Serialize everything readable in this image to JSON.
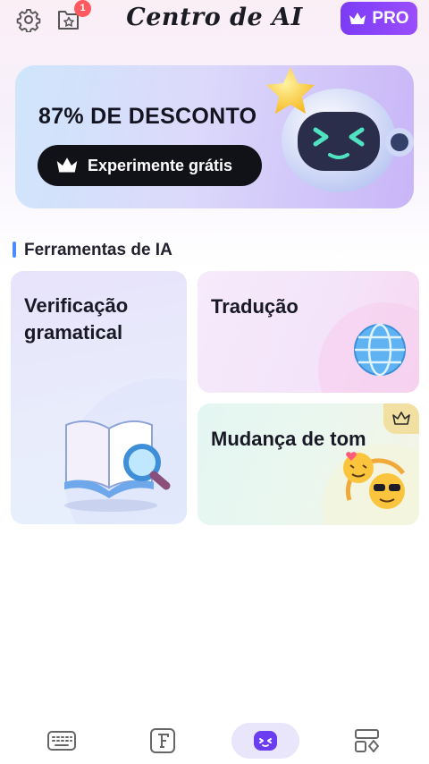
{
  "header": {
    "title": "Centro de AI",
    "badge_count": "1",
    "pro_label": "PRO"
  },
  "promo": {
    "title": "87% DE DESCONTO",
    "button_label": "Experimente grátis"
  },
  "section": {
    "label": "Ferramentas de IA"
  },
  "tools": [
    {
      "label": "Verificação gramatical"
    },
    {
      "label": "Tradução"
    },
    {
      "label": "Mudança de tom",
      "premium": true
    }
  ],
  "bottom_nav": {
    "items": [
      {
        "icon": "keyboard-icon",
        "active": false
      },
      {
        "icon": "fonts-icon",
        "active": false
      },
      {
        "icon": "ai-robot-icon",
        "active": true
      },
      {
        "icon": "tools-icon",
        "active": false
      }
    ]
  },
  "colors": {
    "accent": "#7b3cf5",
    "section_bar": "#4a8cff",
    "badge": "#ff5a5f",
    "premium_tag": "#f2e0a3"
  }
}
